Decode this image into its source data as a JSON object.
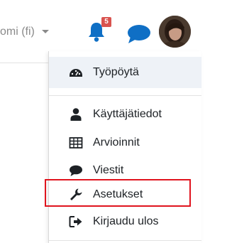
{
  "header": {
    "language_label": "omi (fi)",
    "notification_count": "5"
  },
  "user_menu": {
    "items": [
      {
        "label": "Työpöytä",
        "icon": "dashboard-icon"
      },
      {
        "label": "Käyttäjätiedot",
        "icon": "user-icon"
      },
      {
        "label": "Arvioinnit",
        "icon": "grades-table-icon"
      },
      {
        "label": "Viestit",
        "icon": "message-icon"
      },
      {
        "label": "Asetukset",
        "icon": "wrench-icon"
      },
      {
        "label": "Kirjaudu ulos",
        "icon": "logout-icon"
      }
    ]
  },
  "colors": {
    "accent_blue": "#0f6fc5",
    "badge_red": "#d9534f",
    "focus_red": "#e0141e"
  }
}
